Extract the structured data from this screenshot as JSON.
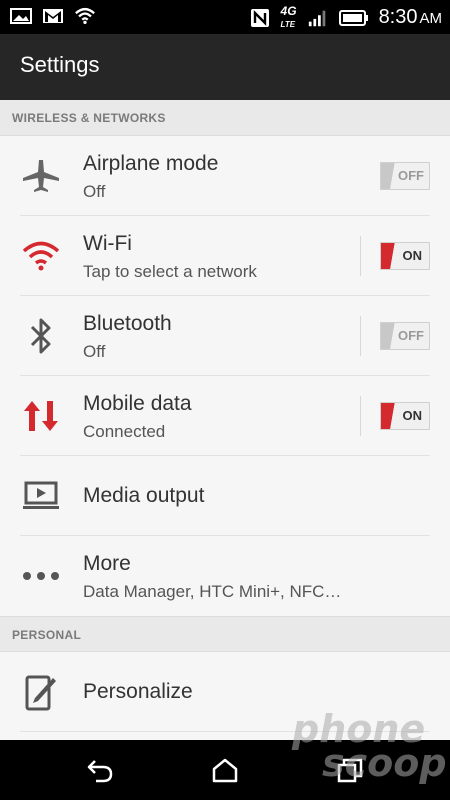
{
  "status_bar": {
    "time": "8:30",
    "ampm": "AM",
    "network": "4G LTE",
    "icons": [
      "gallery-icon",
      "gmail-icon",
      "wifi-icon",
      "nfc-icon",
      "4g-lte-icon",
      "signal-icon",
      "battery-icon"
    ]
  },
  "header": {
    "title": "Settings"
  },
  "sections": {
    "wireless": {
      "label": "WIRELESS & NETWORKS"
    },
    "personal": {
      "label": "PERSONAL"
    }
  },
  "items": {
    "airplane": {
      "title": "Airplane mode",
      "subtitle": "Off",
      "toggle": "OFF"
    },
    "wifi": {
      "title": "Wi-Fi",
      "subtitle": "Tap to select a network",
      "toggle": "ON"
    },
    "bluetooth": {
      "title": "Bluetooth",
      "subtitle": "Off",
      "toggle": "OFF"
    },
    "mobile_data": {
      "title": "Mobile data",
      "subtitle": "Connected",
      "toggle": "ON"
    },
    "media_output": {
      "title": "Media output"
    },
    "more": {
      "title": "More",
      "subtitle": "Data Manager, HTC Mini+, NFC…"
    },
    "personalize": {
      "title": "Personalize"
    }
  },
  "nav": {
    "icons": [
      "back-icon",
      "home-icon",
      "recents-icon"
    ]
  },
  "watermark": {
    "line1": "phone",
    "line2": "scoop"
  },
  "colors": {
    "accent": "#d4292f",
    "titlebar": "#262626",
    "statusbar": "#000000"
  }
}
